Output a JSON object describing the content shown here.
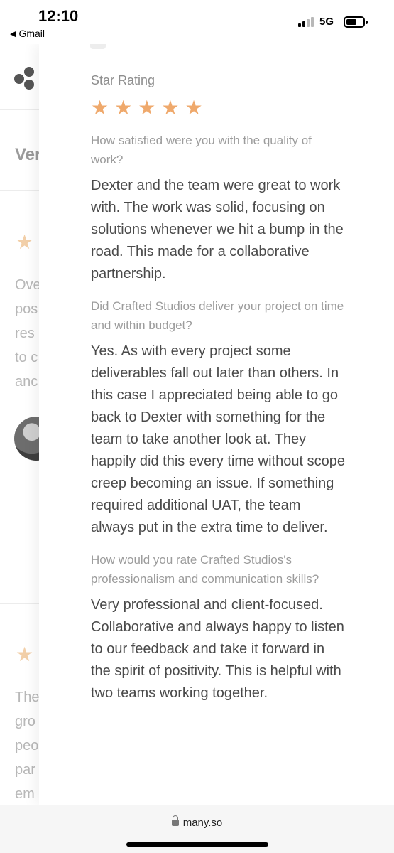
{
  "status_bar": {
    "time": "12:10",
    "back_app": "Gmail",
    "network": "5G",
    "battery_level": 0.45
  },
  "background_page": {
    "heading": "Ver",
    "review1_lines": [
      "Ove",
      "pos",
      "res",
      "to c",
      "anc"
    ],
    "review2_lines": [
      "The",
      "gro",
      "peo",
      "par",
      "em"
    ]
  },
  "review": {
    "star_label": "Star Rating",
    "rating": 5,
    "stars": [
      "★",
      "★",
      "★",
      "★",
      "★"
    ],
    "questions": [
      {
        "question": "How satisfied were you with the quality of work?",
        "answer": "Dexter and the team were great to work with. The work was solid, focusing on solutions whenever we hit a bump in the road. This made for a collaborative partnership."
      },
      {
        "question": "Did Crafted Studios deliver your project on time and within budget?",
        "answer": "Yes. As with every project some deliverables fall out later than others. In this case I appreciated being able to go back to Dexter with something for the team to take another look at. They happily did this every time without scope creep becoming an issue. If something required additional UAT, the team always put in the extra time to deliver."
      },
      {
        "question": "How would you rate Crafted Studios's professionalism and communication skills?",
        "answer": "Very professional and client-focused. Collaborative and always happy to listen to our feedback and take it forward in the spirit of positivity. This is helpful with two teams working together."
      }
    ]
  },
  "browser": {
    "url": "many.so"
  },
  "colors": {
    "star": "#efa96c",
    "background_star": "#f2cfa8"
  }
}
